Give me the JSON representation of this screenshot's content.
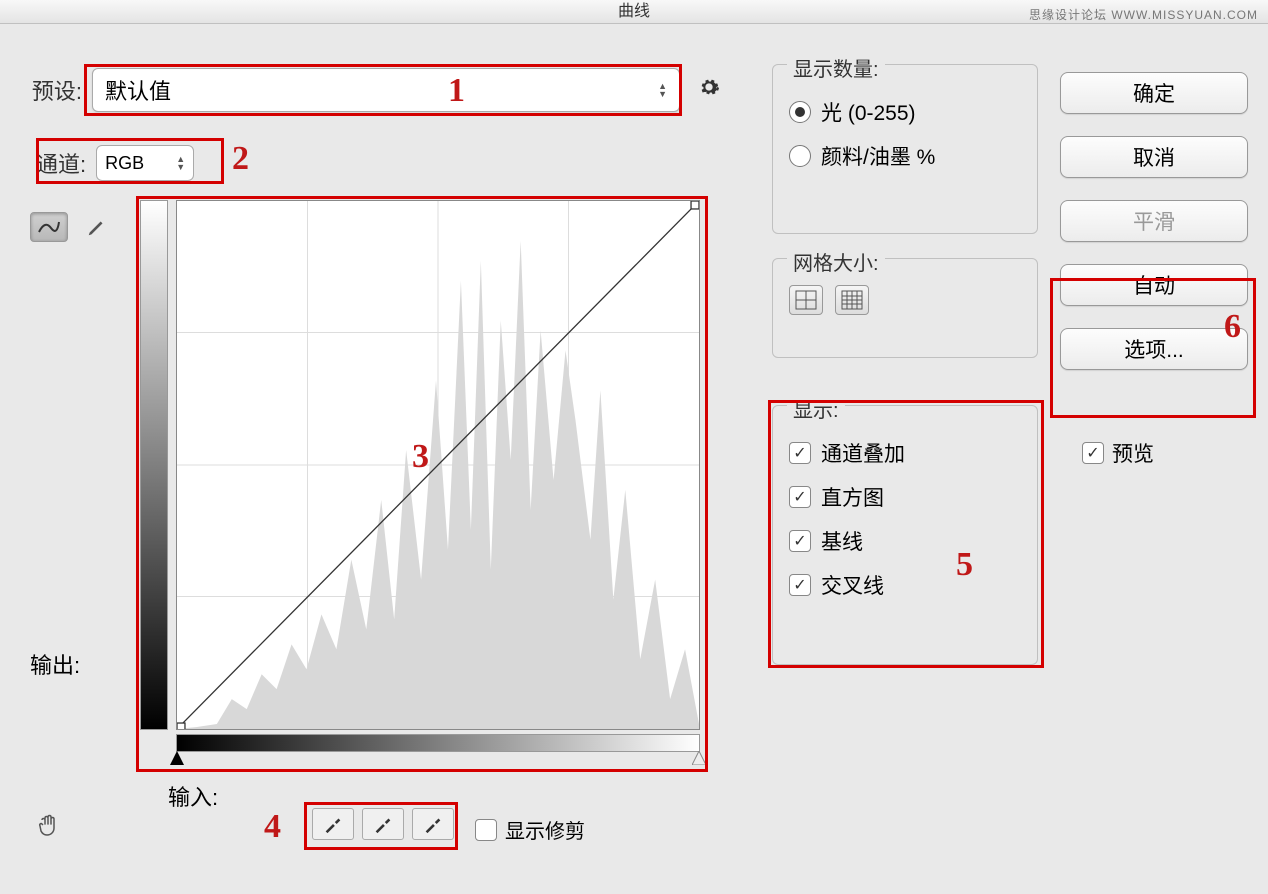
{
  "title": "曲线",
  "watermark": "思缘设计论坛 WWW.MISSYUAN.COM",
  "preset": {
    "label": "预设:",
    "value": "默认值"
  },
  "channel": {
    "label": "通道:",
    "value": "RGB"
  },
  "output_label": "输出:",
  "input_label": "输入:",
  "show_clip_label": "显示修剪",
  "groups": {
    "amount": {
      "title": "显示数量:",
      "opt_light": "光 (0-255)",
      "opt_pigment": "颜料/油墨 %"
    },
    "grid": {
      "title": "网格大小:"
    },
    "show": {
      "title": "显示:",
      "overlay": "通道叠加",
      "histogram": "直方图",
      "baseline": "基线",
      "intersection": "交叉线"
    }
  },
  "buttons": {
    "ok": "确定",
    "cancel": "取消",
    "smooth": "平滑",
    "auto": "自动",
    "options": "选项..."
  },
  "preview_label": "预览",
  "annotations": {
    "n1": "1",
    "n2": "2",
    "n3": "3",
    "n4": "4",
    "n5": "5",
    "n6": "6"
  }
}
